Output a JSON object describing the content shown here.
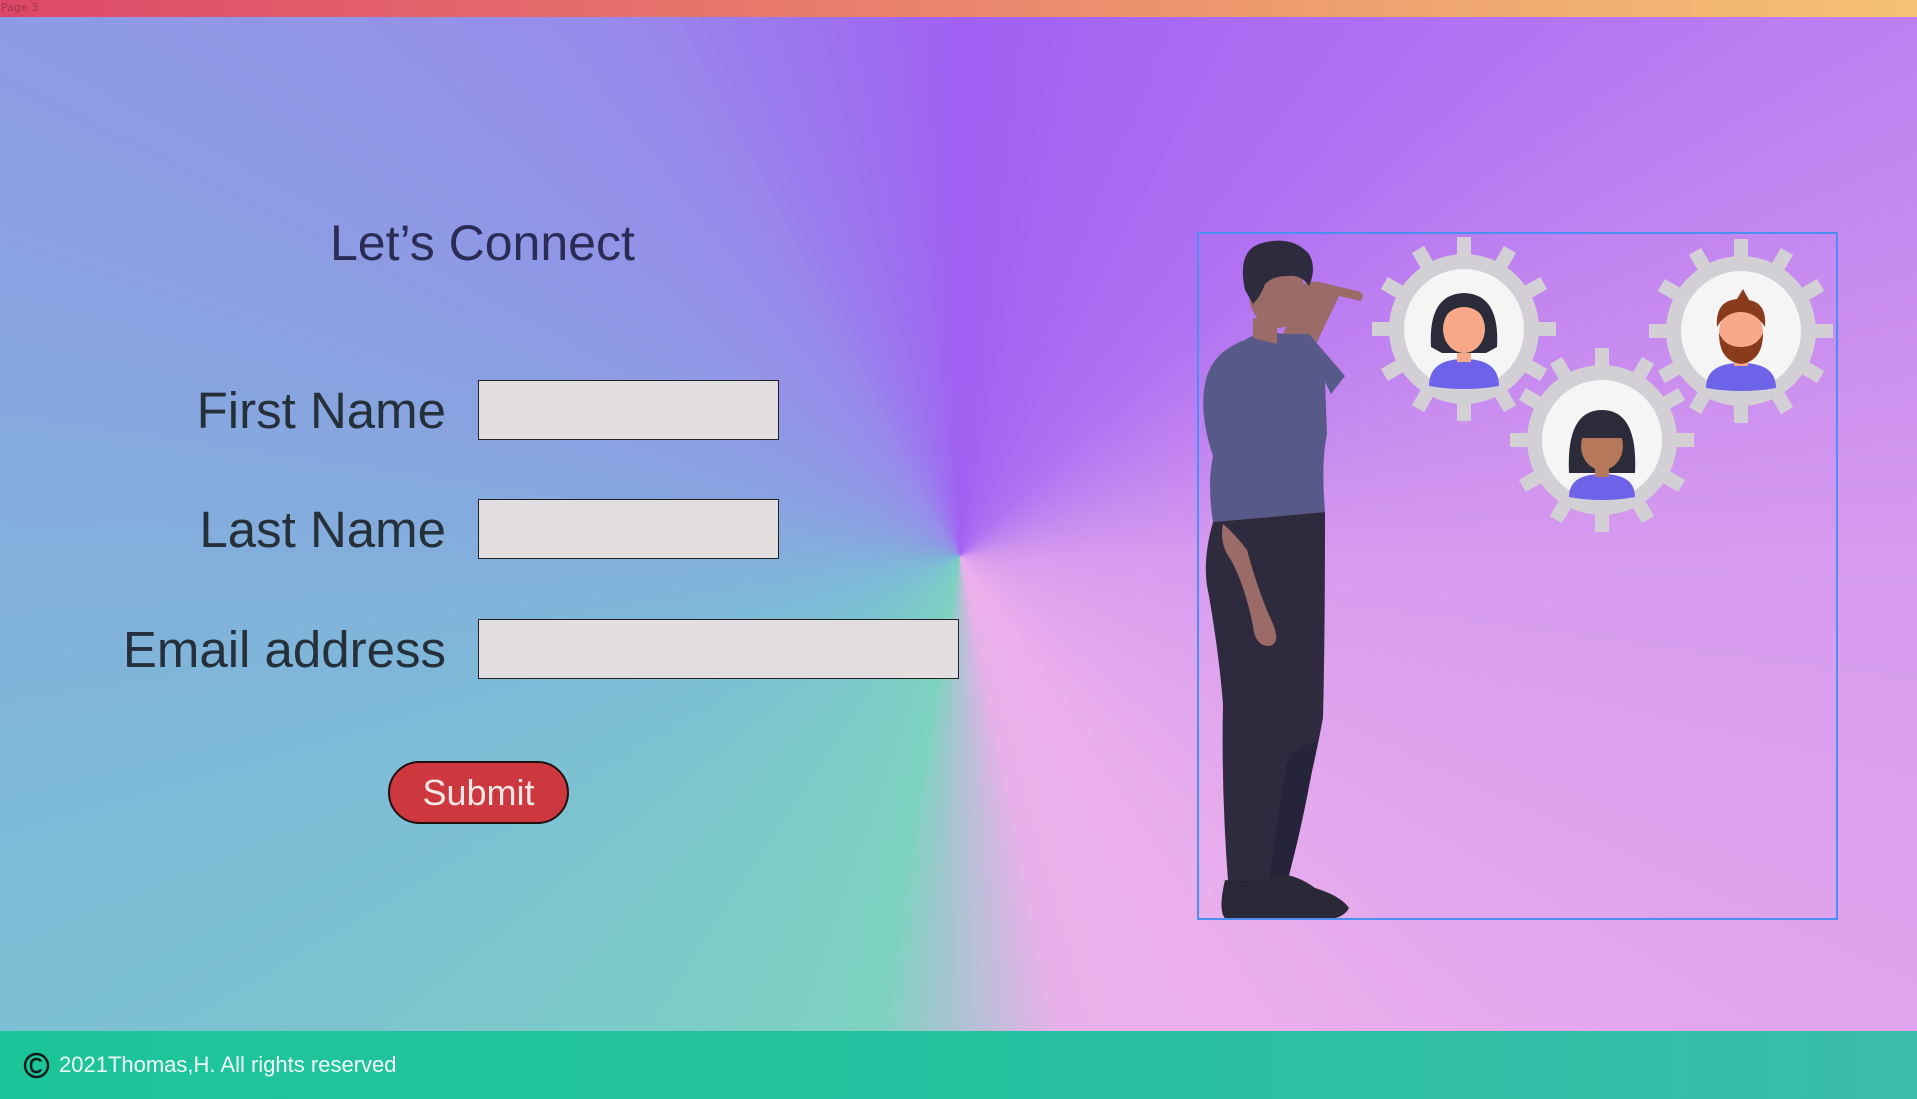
{
  "page_label": "Page 3",
  "form": {
    "title": "Let’s Connect",
    "first_name_label": "First Name",
    "last_name_label": "Last Name",
    "email_label": "Email address",
    "first_name_value": "",
    "last_name_value": "",
    "email_value": "",
    "submit_label": "Submit"
  },
  "illustration": {
    "icon": "team-gears-illustration",
    "people": [
      "woman-avatar",
      "bearded-man-avatar",
      "girl-avatar"
    ]
  },
  "footer": {
    "icon": "copyright-icon",
    "text": "2021Thomas,H. All rights reserved"
  },
  "colors": {
    "top_bar_start": "#dc4868",
    "top_bar_end": "#f4c275",
    "footer": "#1cc49a",
    "submit_button": "#cc383d",
    "input_background": "#e2dedf",
    "illustration_border": "#4b8ff0",
    "title_text": "#2b2c55"
  }
}
